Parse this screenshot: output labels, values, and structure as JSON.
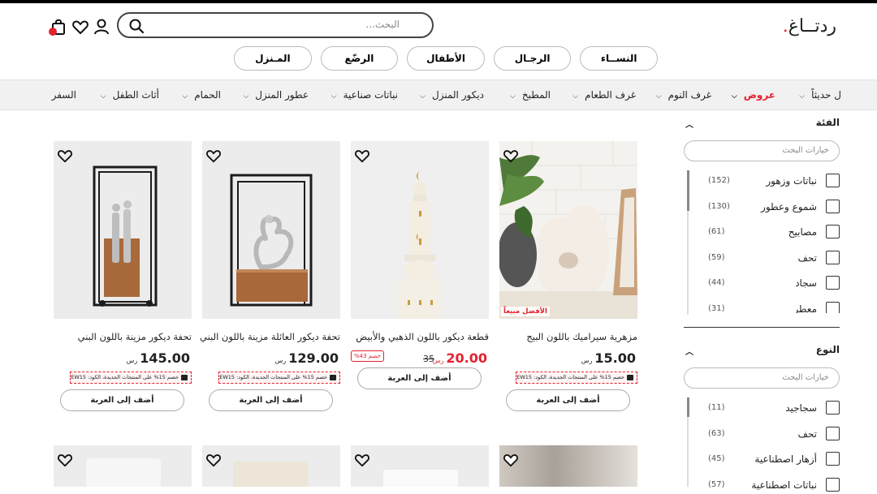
{
  "brand": {
    "logo_text": "ردتــاغ",
    "logo_dot": ".",
    "accent": "#e4212d"
  },
  "search": {
    "placeholder": "البحث..."
  },
  "header_icons": [
    "user-icon",
    "heart-icon",
    "shopping-bag-icon"
  ],
  "categories": [
    "النســاء",
    "الرجـال",
    "الأطفال",
    "الرضّع",
    "المـنزل"
  ],
  "nav": {
    "items": [
      {
        "label": "ل حديثاً",
        "chevron": true
      },
      {
        "label": "عروض",
        "chevron": true,
        "highlight": true
      },
      {
        "label": "غرف النوم",
        "chevron": true
      },
      {
        "label": "غرف الطعام",
        "chevron": true
      },
      {
        "label": "المطبخ",
        "chevron": true
      },
      {
        "label": "ديكور المنزل",
        "chevron": true
      },
      {
        "label": "نباتات صناعية",
        "chevron": true
      },
      {
        "label": "عطور المنزل",
        "chevron": true
      },
      {
        "label": "الحمام",
        "chevron": true
      },
      {
        "label": "أثاث الطفل",
        "chevron": true
      },
      {
        "label": "السفر",
        "chevron": false
      }
    ]
  },
  "filters": {
    "category": {
      "title": "الفئة",
      "search_placeholder": "خيارات البحث",
      "options": [
        {
          "label": "نباتات وزهور",
          "count": "(152)"
        },
        {
          "label": "شموع وعطور",
          "count": "(130)"
        },
        {
          "label": "مصابيح",
          "count": "(61)"
        },
        {
          "label": "تحف",
          "count": "(59)"
        },
        {
          "label": "سجاد",
          "count": "(44)"
        },
        {
          "label": "معطر",
          "count": "(31)"
        }
      ]
    },
    "type": {
      "title": "النوع",
      "search_placeholder": "خيارات البحث",
      "options": [
        {
          "label": "سجاجيد",
          "count": "(11)"
        },
        {
          "label": "تحف",
          "count": "(63)"
        },
        {
          "label": "أزهار اصطناعية",
          "count": "(45)"
        },
        {
          "label": "نباتات اصطناعية",
          "count": "(57)"
        }
      ]
    }
  },
  "products": [
    {
      "title": "مزهرية سيراميك باللون البيج",
      "price": "15.00",
      "currency": "رس",
      "promo": "خصم 15% على المنتجات الجديدة، الكود: NEW15",
      "button": "أضف إلى العربة",
      "badge": "الأفضل مبيعاً"
    },
    {
      "title": "قطعة ديكور باللون الذهبي والأبيض",
      "price": "20.00",
      "currency": "رس",
      "old_price": "35",
      "discount": "خصم 43%",
      "button": "أضف إلى العربة"
    },
    {
      "title": "تحفة ديكور العائلة مزينة باللون البني",
      "price": "129.00",
      "currency": "رس",
      "promo": "خصم 15% على المنتجات الجديدة، الكود: NEW15",
      "button": "أضف إلى العربة"
    },
    {
      "title": "تحفة ديكور مزينة باللون البني",
      "price": "145.00",
      "currency": "رس",
      "promo": "خصم 15% على المنتجات الجديدة، الكود: NEW15",
      "button": "أضف إلى العربة"
    }
  ]
}
